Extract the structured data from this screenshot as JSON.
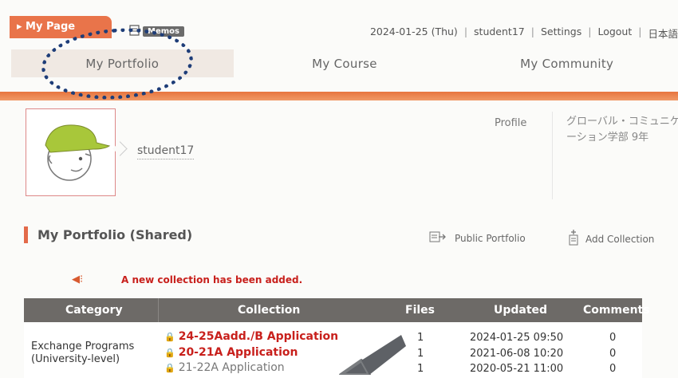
{
  "header": {
    "mypage_tab": "▸ My Page",
    "memo_label": "Memos",
    "date": "2024-01-25 (Thu)",
    "user": "student17",
    "settings": "Settings",
    "logout": "Logout",
    "language": "日本語",
    "separator": "|"
  },
  "nav": {
    "tabs": [
      {
        "label": "My Portfolio",
        "active": true
      },
      {
        "label": "My Course"
      },
      {
        "label": "My Community"
      }
    ]
  },
  "profile": {
    "username": "student17",
    "label": "Profile",
    "value": "グローバル・コミュニケーション学部 9年"
  },
  "portfolio": {
    "title": "My Portfolio (Shared)",
    "public_portfolio": "Public Portfolio",
    "add_collection": "Add Collection",
    "notice": "A new collection has been added."
  },
  "table": {
    "headers": [
      "Category",
      "Collection",
      "Files",
      "Updated",
      "Comments"
    ],
    "category": "Exchange Programs (University-level)",
    "rows": [
      {
        "collection": "24-25Aadd./B Application",
        "files": "1",
        "updated": "2024-01-25 09:50",
        "comments": "0"
      },
      {
        "collection": "20-21A Application",
        "files": "1",
        "updated": "2021-06-08 10:20",
        "comments": "0"
      },
      {
        "collection": "21-22A Application",
        "files": "1",
        "updated": "2020-05-21 11:00",
        "comments": "0"
      }
    ]
  },
  "colors": {
    "accent": "#e9744a",
    "alert_red": "#c8201c",
    "table_header": "#6d6a67",
    "annotation": "#1e3d78"
  }
}
